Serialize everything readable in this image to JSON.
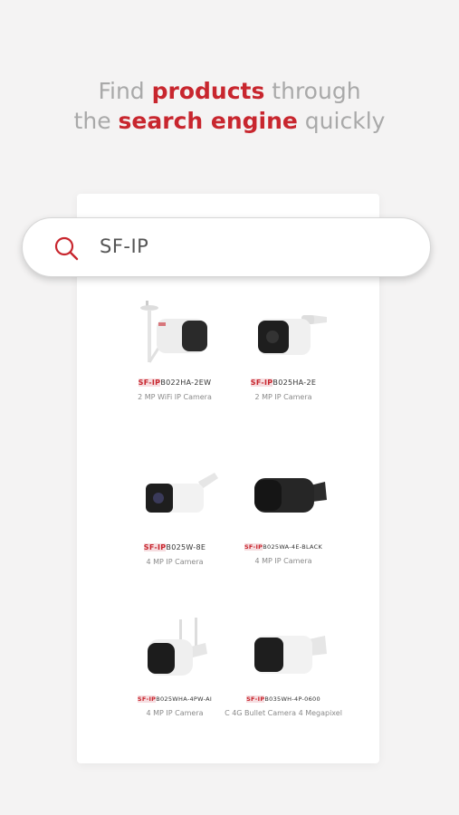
{
  "headline": {
    "line1_a": "Find ",
    "line1_hl": "products",
    "line1_b": " through",
    "line2_a": "the ",
    "line2_hl": "search engine",
    "line2_b": " quickly"
  },
  "search": {
    "value": "SF-IP",
    "icon": "search-icon"
  },
  "colors": {
    "accent": "#c8262e",
    "background": "#f4f3f3"
  },
  "products": [
    {
      "match": "SF-IP",
      "rest": "B022HA-2EW",
      "desc": "2 MP WiFi IP Camera",
      "icon": "wifi-bullet-camera-icon"
    },
    {
      "match": "SF-IP",
      "rest": "B025HA-2E",
      "desc": "2 MP IP Camera",
      "icon": "bullet-camera-icon"
    },
    {
      "match": "SF-IP",
      "rest": "B025W-8E",
      "desc": "4 MP IP Camera",
      "icon": "bullet-camera-icon"
    },
    {
      "match": "SF-IP",
      "rest": "B025WA-4E-BLACK",
      "desc": "4 MP IP Camera",
      "icon": "black-bullet-camera-icon"
    },
    {
      "match": "SF-IP",
      "rest": "B025WHA-4PW-AI",
      "desc": "4 MP IP Camera",
      "icon": "wifi-bullet-camera-icon"
    },
    {
      "match": "SF-IP",
      "rest": "B035WH-4P-0600",
      "desc": "C 4G Bullet Camera 4 Megapixel",
      "icon": "bullet-camera-icon"
    }
  ]
}
